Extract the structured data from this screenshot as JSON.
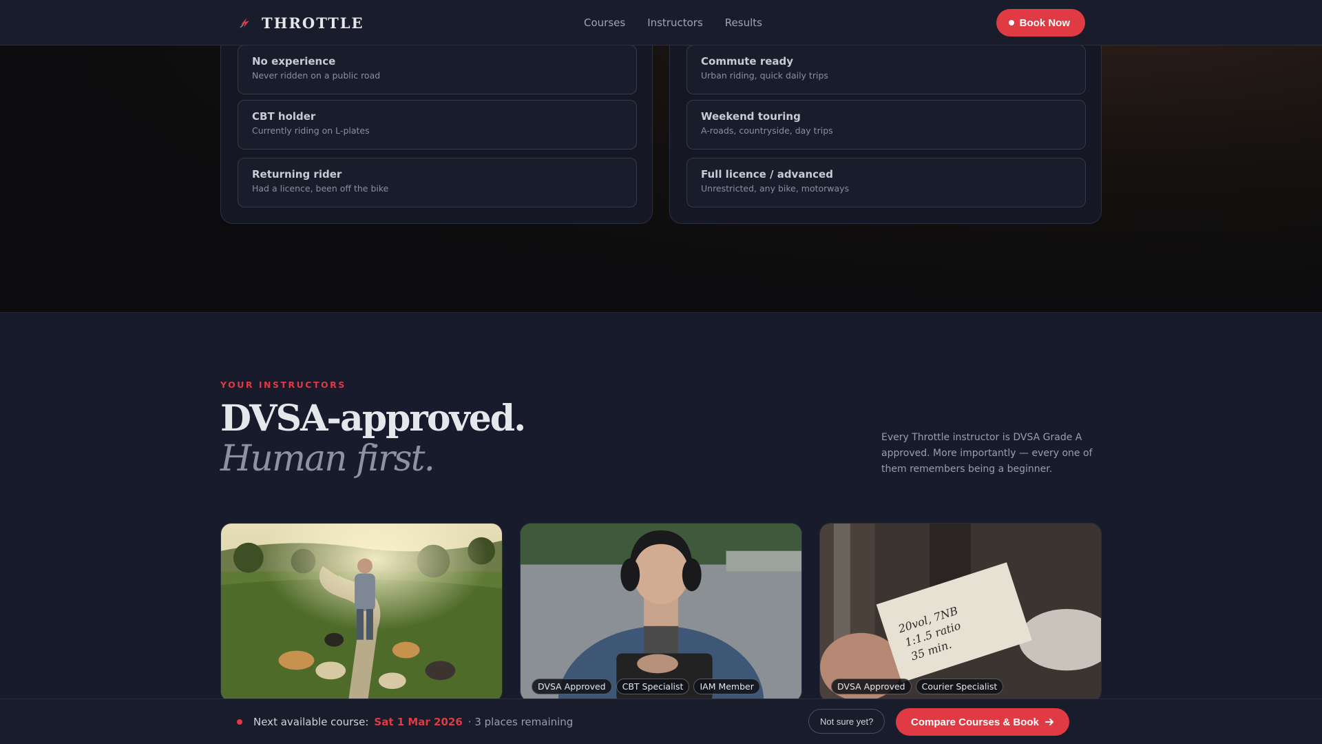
{
  "nav": {
    "brand": "THROTTLE",
    "links": [
      "Courses",
      "Instructors",
      "Results"
    ],
    "book_label": "Book Now"
  },
  "experience": {
    "left": [
      {
        "title": "No experience",
        "sub": "Never ridden on a public road"
      },
      {
        "title": "CBT holder",
        "sub": "Currently riding on L-plates"
      },
      {
        "title": "Returning rider",
        "sub": "Had a licence, been off the bike"
      }
    ],
    "right": [
      {
        "title": "Commute ready",
        "sub": "Urban riding, quick daily trips"
      },
      {
        "title": "Weekend touring",
        "sub": "A-roads, countryside, day trips"
      },
      {
        "title": "Full licence / advanced",
        "sub": "Unrestricted, any bike, motorways"
      }
    ]
  },
  "instructors": {
    "eyebrow": "YOUR INSTRUCTORS",
    "headline": "DVSA-approved.",
    "headline_italic": "Human first.",
    "intro": "Every Throttle instructor is DVSA Grade A approved. More importantly — every one of them remembers being a beginner.",
    "cards": [
      {
        "badges": []
      },
      {
        "badges": [
          "DVSA Approved",
          "CBT Specialist",
          "IAM Member"
        ]
      },
      {
        "badges": [
          "DVSA Approved",
          "Courier Specialist"
        ]
      }
    ],
    "note_lines": [
      "20vol, 7NB",
      "1:1.5 ratio",
      "35 min."
    ]
  },
  "bar": {
    "prefix": "Next available course:",
    "date": "Sat 1 Mar 2026",
    "suffix": "· 3 places remaining",
    "not_sure": "Not sure yet?",
    "compare": "Compare Courses & Book"
  },
  "colors": {
    "accent": "#e03a45",
    "bg": "#181b2b"
  }
}
